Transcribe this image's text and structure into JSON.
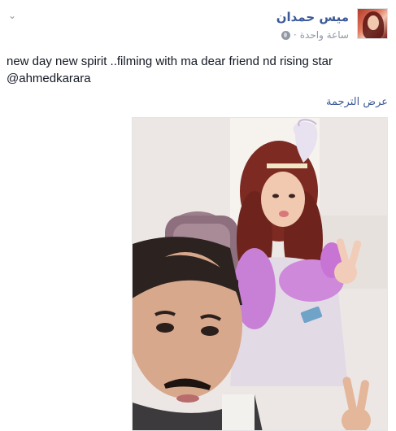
{
  "post": {
    "author_name": "ميس حمدان",
    "timestamp": "ساعة واحدة",
    "separator": "·",
    "privacy_icon": "globe-icon",
    "text": "new day new spirit ..filming with ma dear friend nd rising star @ahmedkarara",
    "see_translation": "عرض الترجمة",
    "options_icon": "chevron-down-icon"
  },
  "photo": {
    "description_icon": "photo-image"
  },
  "colors": {
    "link": "#3b5998",
    "meta": "#9197a3",
    "text": "#141823"
  }
}
